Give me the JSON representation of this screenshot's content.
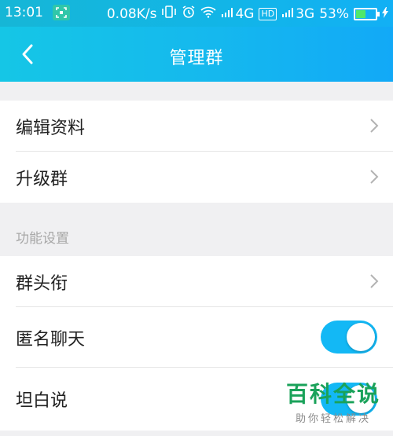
{
  "status_bar": {
    "time": "13:01",
    "net_speed": "0.08K/s",
    "signal1": "4G",
    "hd": "HD",
    "signal2": "3G",
    "battery": "53%",
    "battery_level": 0.53
  },
  "header": {
    "title": "管理群"
  },
  "main": {
    "items_top": [
      {
        "label": "编辑资料"
      },
      {
        "label": "升级群"
      }
    ],
    "section_title": "功能设置",
    "items_func": [
      {
        "label": "群头衔"
      },
      {
        "label": "匿名聊天",
        "toggle": true
      },
      {
        "label": "坦白说",
        "toggle": true
      }
    ]
  },
  "watermark": {
    "main": "百科全说",
    "sub": "助你轻松解决"
  },
  "colors": {
    "accent": "#13b8f5",
    "header": "#15b8ee",
    "watermark": "#1aa25a"
  }
}
